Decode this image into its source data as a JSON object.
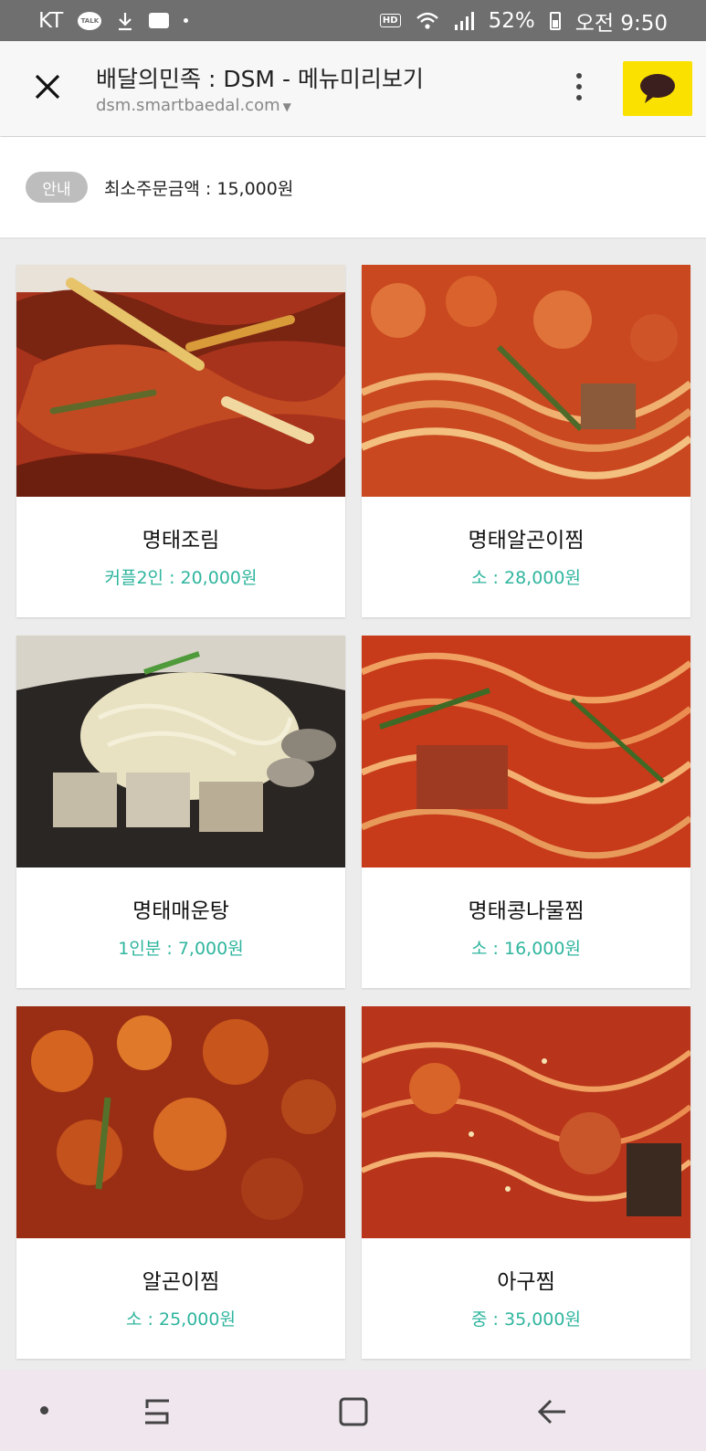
{
  "status_bar": {
    "carrier": "KT",
    "talk_label": "TALK",
    "battery": "52%",
    "time": "오전 9:50",
    "hd_label": "HD"
  },
  "browser": {
    "title": "배달의민족 : DSM - 메뉴미리보기",
    "url": "dsm.smartbaedal.com"
  },
  "notice": {
    "badge": "안내",
    "text": "최소주문금액 : 15,000원"
  },
  "menu": {
    "items": [
      {
        "name": "명태조림",
        "price": "커플2인 : 20,000원"
      },
      {
        "name": "명태알곤이찜",
        "price": "소 : 28,000원"
      },
      {
        "name": "명태매운탕",
        "price": "1인분 : 7,000원"
      },
      {
        "name": "명태콩나물찜",
        "price": "소 : 16,000원"
      },
      {
        "name": "알곤이찜",
        "price": "소 : 25,000원"
      },
      {
        "name": "아구찜",
        "price": "중 : 35,000원"
      }
    ]
  },
  "colors": {
    "price": "#2fb59e",
    "kakao": "#fae100",
    "status_bar": "#6f6f6f"
  }
}
